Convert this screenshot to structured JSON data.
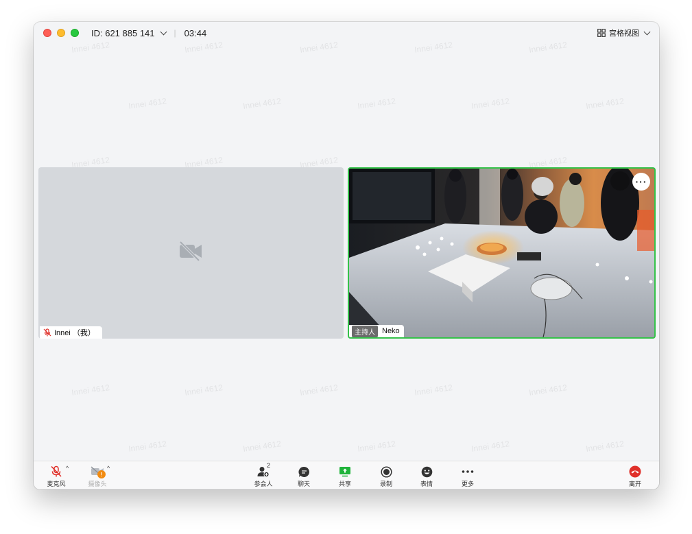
{
  "titlebar": {
    "meeting_id": "ID: 621 885 141",
    "timer": "03:44",
    "view_label": "宫格视图"
  },
  "watermark_text": "Innei 4612",
  "participants": {
    "self_name": "Innei （我）",
    "host_badge": "主持人",
    "host_name": "Neko",
    "more_label": "···"
  },
  "toolbar": {
    "mic_label": "麦克风",
    "camera_label": "摄像头",
    "camera_warning": "!",
    "participants_label": "参会人",
    "participants_count": "2",
    "chat_label": "聊天",
    "share_label": "共享",
    "record_label": "录制",
    "reactions_label": "表情",
    "more_label": "更多",
    "leave_label": "离开"
  },
  "colors": {
    "active_speaker_border": "#35c24a",
    "leave_red": "#e0302a",
    "share_green": "#1fb33a",
    "muted_red": "#e0302a",
    "warning_orange": "#f28b10"
  }
}
